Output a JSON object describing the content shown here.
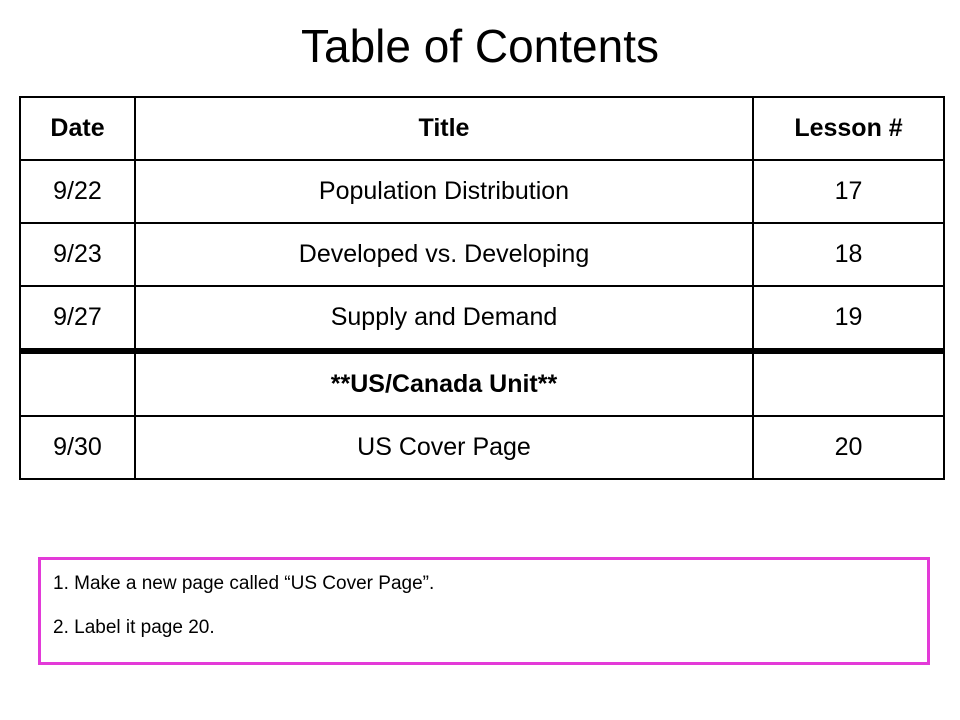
{
  "title": "Table of Contents",
  "table": {
    "headers": {
      "date": "Date",
      "title": "Title",
      "lesson": "Lesson #"
    },
    "rows": [
      {
        "date": "9/22",
        "title": "Population Distribution",
        "lesson": "17"
      },
      {
        "date": "9/23",
        "title": "Developed vs. Developing",
        "lesson": "18"
      },
      {
        "date": "9/27",
        "title": "Supply and Demand",
        "lesson": "19"
      }
    ],
    "unit": {
      "date": "",
      "title": "**US/Canada Unit**",
      "lesson": ""
    },
    "rows_after": [
      {
        "date": "9/30",
        "title": "US Cover Page",
        "lesson": "20"
      }
    ]
  },
  "notes": {
    "line1": "1. Make a new page called “US Cover Page”.",
    "line2": "2. Label it page 20."
  },
  "colors": {
    "note_border": "#e33ad8"
  }
}
